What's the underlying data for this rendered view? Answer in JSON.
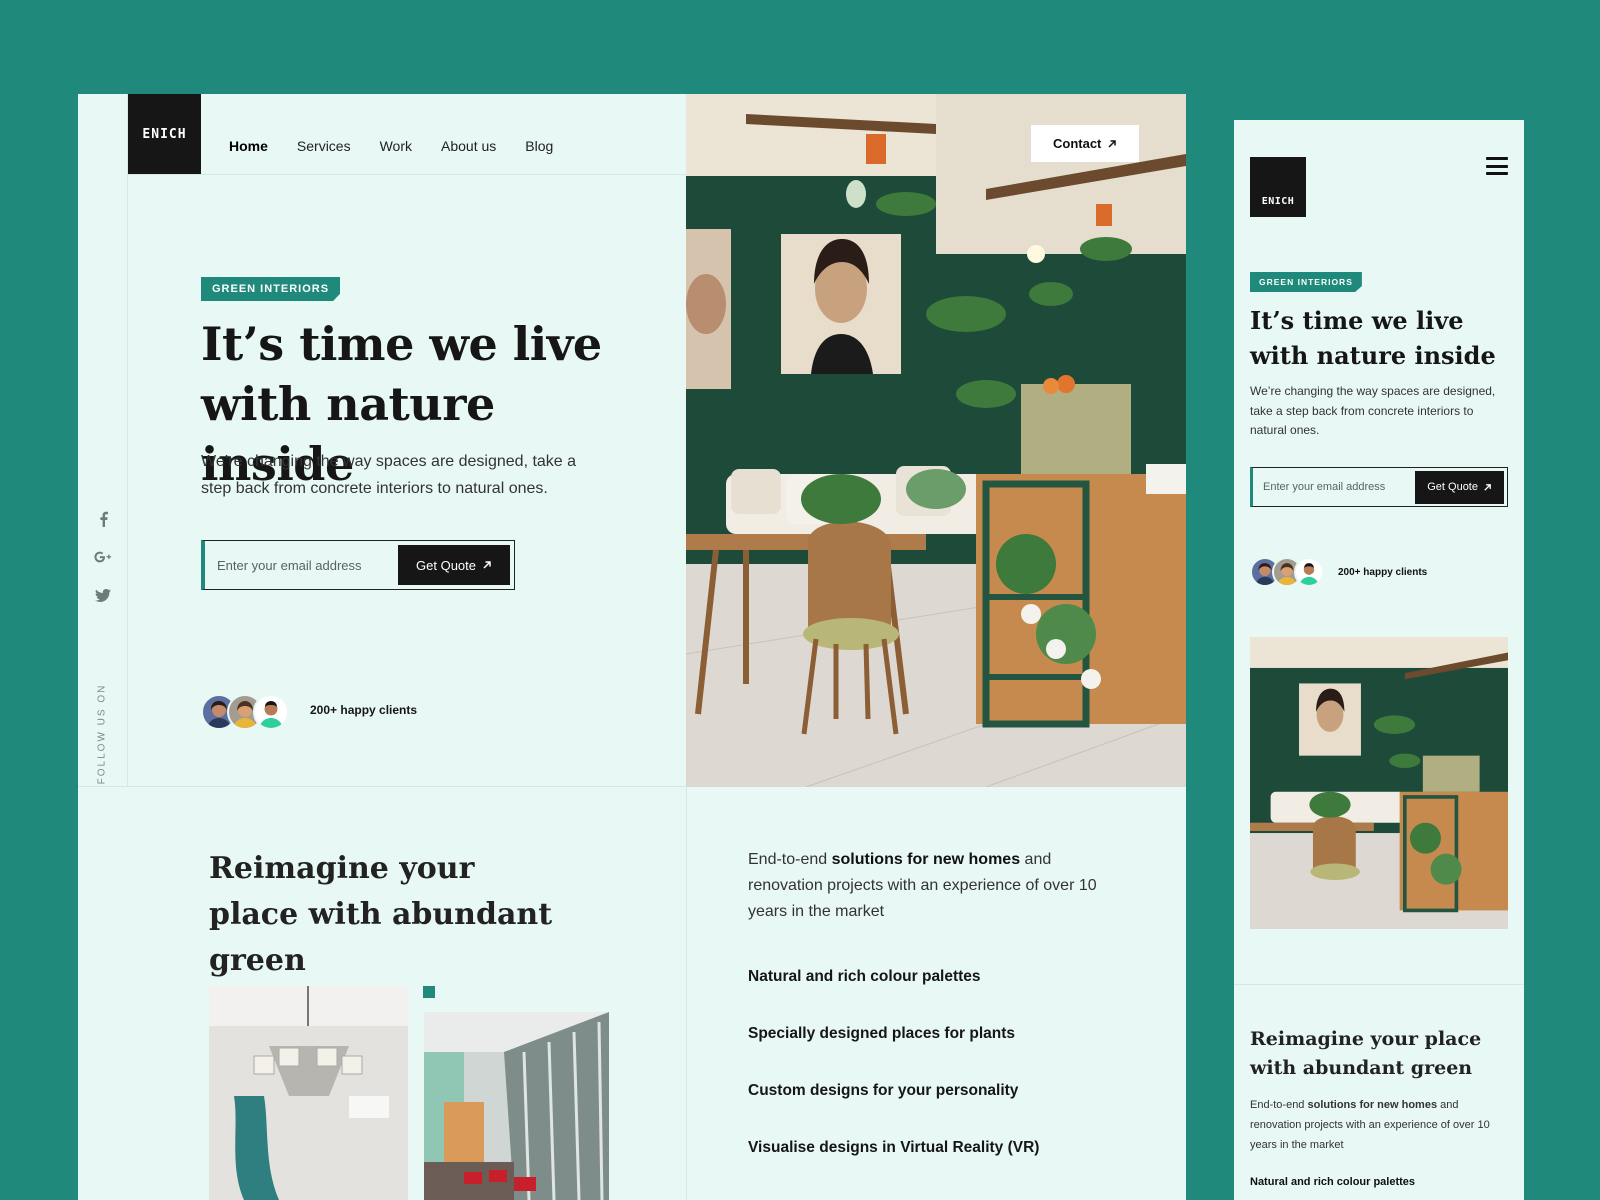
{
  "brand": {
    "logo_text": "ENICH"
  },
  "nav": {
    "items": [
      "Home",
      "Services",
      "Work",
      "About us",
      "Blog"
    ],
    "active": "Home",
    "contact_label": "Contact"
  },
  "social": {
    "icons": [
      "facebook-icon",
      "google-plus-icon",
      "twitter-icon"
    ],
    "follow_label": "FOLLOW US ON"
  },
  "hero": {
    "badge": "GREEN INTERIORS",
    "title": "It’s time we live with nature inside",
    "subtitle": "We’re changing the way spaces are designed, take a step back from concrete interiors to natural ones.",
    "email_placeholder": "Enter your email address",
    "cta_label": "Get Quote",
    "clients_label": "200+ happy clients"
  },
  "section2": {
    "title": "Reimagine your place with abundant green",
    "intro_before": "End-to-end",
    "intro_bold": "solutions for new homes",
    "intro_after": "and renovation projects with an experience of over 10 years in the market",
    "features": [
      "Natural and rich colour palettes",
      "Specially designed places for plants",
      "Custom designs for your personality",
      "Visualise designs in Virtual Reality (VR)"
    ]
  },
  "colors": {
    "background": "#1f8a7c",
    "page": "#e8f8f4",
    "accent": "#1f8a7c",
    "dark": "#161616",
    "wall": "#1e4a3a"
  }
}
